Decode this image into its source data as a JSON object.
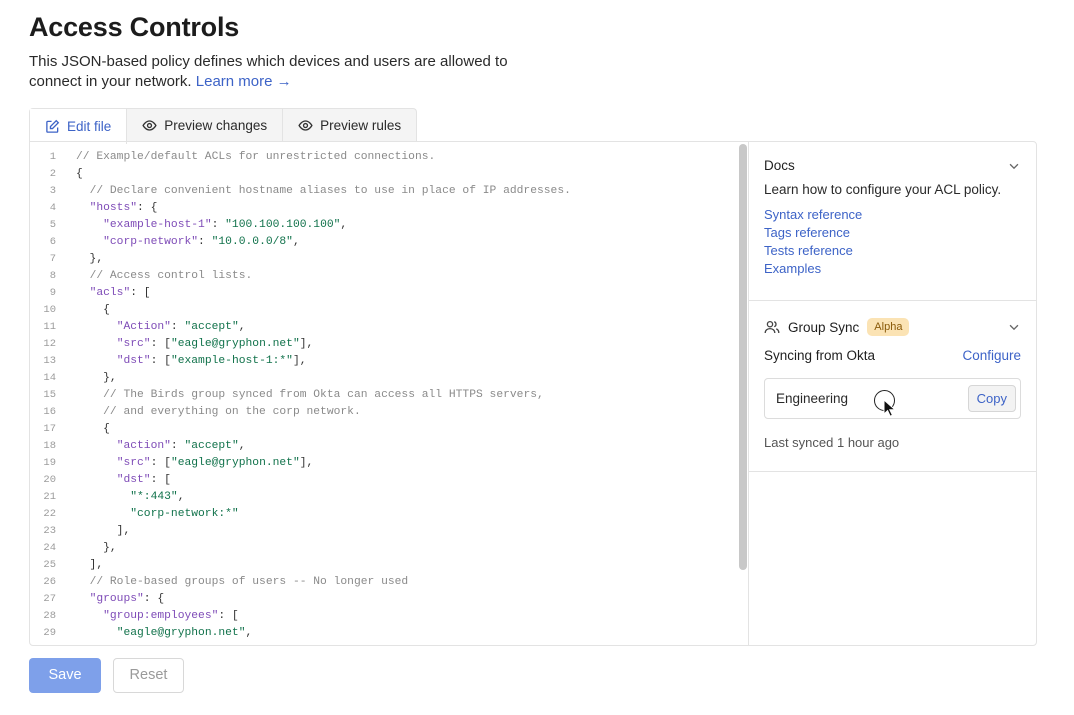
{
  "page": {
    "title": "Access Controls",
    "intro_text": "This JSON-based policy defines which devices and users are allowed to connect in your network.",
    "learn_more": "Learn more →"
  },
  "tabs": [
    {
      "label": "Edit file",
      "icon": "edit-icon",
      "active": true
    },
    {
      "label": "Preview changes",
      "icon": "eye-icon",
      "active": false
    },
    {
      "label": "Preview rules",
      "icon": "eye-icon",
      "active": false
    }
  ],
  "editor": {
    "visible_lines": [
      [
        [
          "c",
          "// Example/default ACLs for unrestricted connections."
        ]
      ],
      [
        [
          "p",
          "{"
        ]
      ],
      [
        [
          "p",
          "  "
        ],
        [
          "c",
          "// Declare convenient hostname aliases to use in place of IP addresses."
        ]
      ],
      [
        [
          "p",
          "  "
        ],
        [
          "k",
          "\"hosts\""
        ],
        [
          "p",
          ": {"
        ]
      ],
      [
        [
          "p",
          "    "
        ],
        [
          "k",
          "\"example-host-1\""
        ],
        [
          "p",
          ": "
        ],
        [
          "s",
          "\"100.100.100.100\""
        ],
        [
          "p",
          ","
        ]
      ],
      [
        [
          "p",
          "    "
        ],
        [
          "k",
          "\"corp-network\""
        ],
        [
          "p",
          ": "
        ],
        [
          "s",
          "\"10.0.0.0/8\""
        ],
        [
          "p",
          ","
        ]
      ],
      [
        [
          "p",
          "  },"
        ]
      ],
      [
        [
          "p",
          "  "
        ],
        [
          "c",
          "// Access control lists."
        ]
      ],
      [
        [
          "p",
          "  "
        ],
        [
          "k",
          "\"acls\""
        ],
        [
          "p",
          ": ["
        ]
      ],
      [
        [
          "p",
          "    {"
        ]
      ],
      [
        [
          "p",
          "      "
        ],
        [
          "k",
          "\"Action\""
        ],
        [
          "p",
          ": "
        ],
        [
          "s",
          "\"accept\""
        ],
        [
          "p",
          ","
        ]
      ],
      [
        [
          "p",
          "      "
        ],
        [
          "k",
          "\"src\""
        ],
        [
          "p",
          ": ["
        ],
        [
          "s",
          "\"eagle@gryphon.net\""
        ],
        [
          "p",
          "],"
        ]
      ],
      [
        [
          "p",
          "      "
        ],
        [
          "k",
          "\"dst\""
        ],
        [
          "p",
          ": ["
        ],
        [
          "s",
          "\"example-host-1:*\""
        ],
        [
          "p",
          "],"
        ]
      ],
      [
        [
          "p",
          "    },"
        ]
      ],
      [
        [
          "p",
          "    "
        ],
        [
          "c",
          "// The Birds group synced from Okta can access all HTTPS servers,"
        ]
      ],
      [
        [
          "p",
          "    "
        ],
        [
          "c",
          "// and everything on the corp network."
        ]
      ],
      [
        [
          "p",
          "    {"
        ]
      ],
      [
        [
          "p",
          "      "
        ],
        [
          "k",
          "\"action\""
        ],
        [
          "p",
          ": "
        ],
        [
          "s",
          "\"accept\""
        ],
        [
          "p",
          ","
        ]
      ],
      [
        [
          "p",
          "      "
        ],
        [
          "k",
          "\"src\""
        ],
        [
          "p",
          ": ["
        ],
        [
          "s",
          "\"eagle@gryphon.net\""
        ],
        [
          "p",
          "],"
        ]
      ],
      [
        [
          "p",
          "      "
        ],
        [
          "k",
          "\"dst\""
        ],
        [
          "p",
          ": ["
        ]
      ],
      [
        [
          "p",
          "        "
        ],
        [
          "s",
          "\"*:443\""
        ],
        [
          "p",
          ","
        ]
      ],
      [
        [
          "p",
          "        "
        ],
        [
          "s",
          "\"corp-network:*\""
        ]
      ],
      [
        [
          "p",
          "      ],"
        ]
      ],
      [
        [
          "p",
          "    },"
        ]
      ],
      [
        [
          "p",
          "  ],"
        ]
      ],
      [
        [
          "p",
          "  "
        ],
        [
          "c",
          "// Role-based groups of users -- No longer used"
        ]
      ],
      [
        [
          "p",
          "  "
        ],
        [
          "k",
          "\"groups\""
        ],
        [
          "p",
          ": {"
        ]
      ],
      [
        [
          "p",
          "    "
        ],
        [
          "k",
          "\"group:employees\""
        ],
        [
          "p",
          ": ["
        ]
      ],
      [
        [
          "p",
          "      "
        ],
        [
          "s",
          "\"eagle@gryphon.net\""
        ],
        [
          "p",
          ","
        ]
      ]
    ]
  },
  "docs": {
    "title": "Docs",
    "description": "Learn how to configure your ACL policy.",
    "links": [
      "Syntax reference",
      "Tags reference",
      "Tests reference",
      "Examples"
    ]
  },
  "group_sync": {
    "title": "Group Sync",
    "badge": "Alpha",
    "syncing_text": "Syncing from Okta",
    "configure": "Configure",
    "group_name": "Engineering",
    "copy_label": "Copy",
    "last_synced": "Last synced 1 hour ago"
  },
  "actions": {
    "save": "Save",
    "reset": "Reset"
  },
  "colors": {
    "accent": "#3d63c7",
    "save_bg": "#7ea0ea",
    "badge_bg": "#fbe3b4",
    "json_key": "#7e4bb7",
    "json_string": "#11724b",
    "comment": "#8a8a8a"
  }
}
